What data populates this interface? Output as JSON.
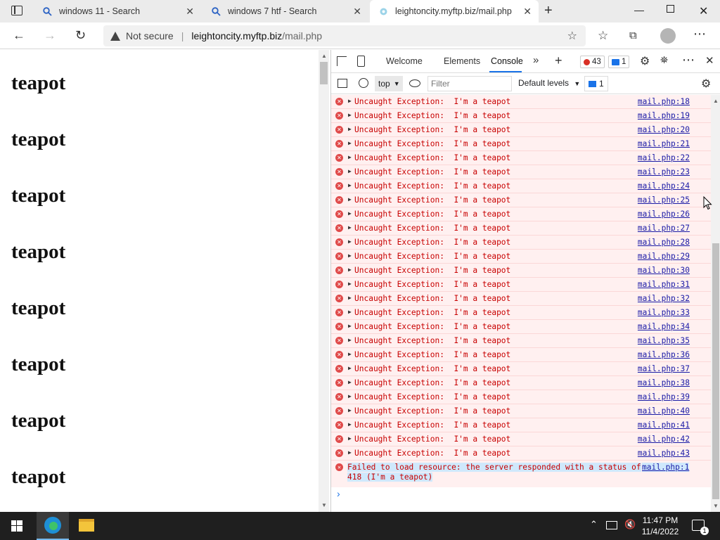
{
  "browser": {
    "tabs": [
      {
        "title": "windows 11 - Search"
      },
      {
        "title": "windows 7 htf - Search"
      },
      {
        "title": "leightoncity.myftp.biz/mail.php"
      }
    ],
    "security_label": "Not secure",
    "url_domain": "leightoncity.myftp.biz",
    "url_path": "/mail.php"
  },
  "page": {
    "headings": [
      "teapot",
      "teapot",
      "teapot",
      "teapot",
      "teapot",
      "teapot",
      "teapot",
      "teapot"
    ]
  },
  "devtools": {
    "tabs": {
      "welcome": "Welcome",
      "elements": "Elements",
      "console": "Console"
    },
    "error_count": "43",
    "message_count": "1",
    "context": "top",
    "filter_placeholder": "Filter",
    "levels": "Default levels",
    "issues_count": "1",
    "console_rows": [
      {
        "msg": "Uncaught Exception:  I'm a teapot",
        "src": "mail.php:18"
      },
      {
        "msg": "Uncaught Exception:  I'm a teapot",
        "src": "mail.php:19"
      },
      {
        "msg": "Uncaught Exception:  I'm a teapot",
        "src": "mail.php:20"
      },
      {
        "msg": "Uncaught Exception:  I'm a teapot",
        "src": "mail.php:21"
      },
      {
        "msg": "Uncaught Exception:  I'm a teapot",
        "src": "mail.php:22"
      },
      {
        "msg": "Uncaught Exception:  I'm a teapot",
        "src": "mail.php:23"
      },
      {
        "msg": "Uncaught Exception:  I'm a teapot",
        "src": "mail.php:24"
      },
      {
        "msg": "Uncaught Exception:  I'm a teapot",
        "src": "mail.php:25"
      },
      {
        "msg": "Uncaught Exception:  I'm a teapot",
        "src": "mail.php:26"
      },
      {
        "msg": "Uncaught Exception:  I'm a teapot",
        "src": "mail.php:27"
      },
      {
        "msg": "Uncaught Exception:  I'm a teapot",
        "src": "mail.php:28"
      },
      {
        "msg": "Uncaught Exception:  I'm a teapot",
        "src": "mail.php:29"
      },
      {
        "msg": "Uncaught Exception:  I'm a teapot",
        "src": "mail.php:30"
      },
      {
        "msg": "Uncaught Exception:  I'm a teapot",
        "src": "mail.php:31"
      },
      {
        "msg": "Uncaught Exception:  I'm a teapot",
        "src": "mail.php:32"
      },
      {
        "msg": "Uncaught Exception:  I'm a teapot",
        "src": "mail.php:33"
      },
      {
        "msg": "Uncaught Exception:  I'm a teapot",
        "src": "mail.php:34"
      },
      {
        "msg": "Uncaught Exception:  I'm a teapot",
        "src": "mail.php:35"
      },
      {
        "msg": "Uncaught Exception:  I'm a teapot",
        "src": "mail.php:36"
      },
      {
        "msg": "Uncaught Exception:  I'm a teapot",
        "src": "mail.php:37"
      },
      {
        "msg": "Uncaught Exception:  I'm a teapot",
        "src": "mail.php:38"
      },
      {
        "msg": "Uncaught Exception:  I'm a teapot",
        "src": "mail.php:39"
      },
      {
        "msg": "Uncaught Exception:  I'm a teapot",
        "src": "mail.php:40"
      },
      {
        "msg": "Uncaught Exception:  I'm a teapot",
        "src": "mail.php:41"
      },
      {
        "msg": "Uncaught Exception:  I'm a teapot",
        "src": "mail.php:42"
      },
      {
        "msg": "Uncaught Exception:  I'm a teapot",
        "src": "mail.php:43"
      }
    ],
    "failed_line1": "Failed to load resource: the server responded with a status of",
    "failed_line2": "418 (I'm a teapot)",
    "failed_src": "mail.php:1",
    "prompt": "›"
  },
  "taskbar": {
    "time": "11:47 PM",
    "date": "11/4/2022",
    "notification_count": "1"
  },
  "colors": {
    "error_text": "#c80000",
    "error_bg": "#fff0f0",
    "link": "#1a1aa6",
    "selection": "#cfe8fc"
  }
}
